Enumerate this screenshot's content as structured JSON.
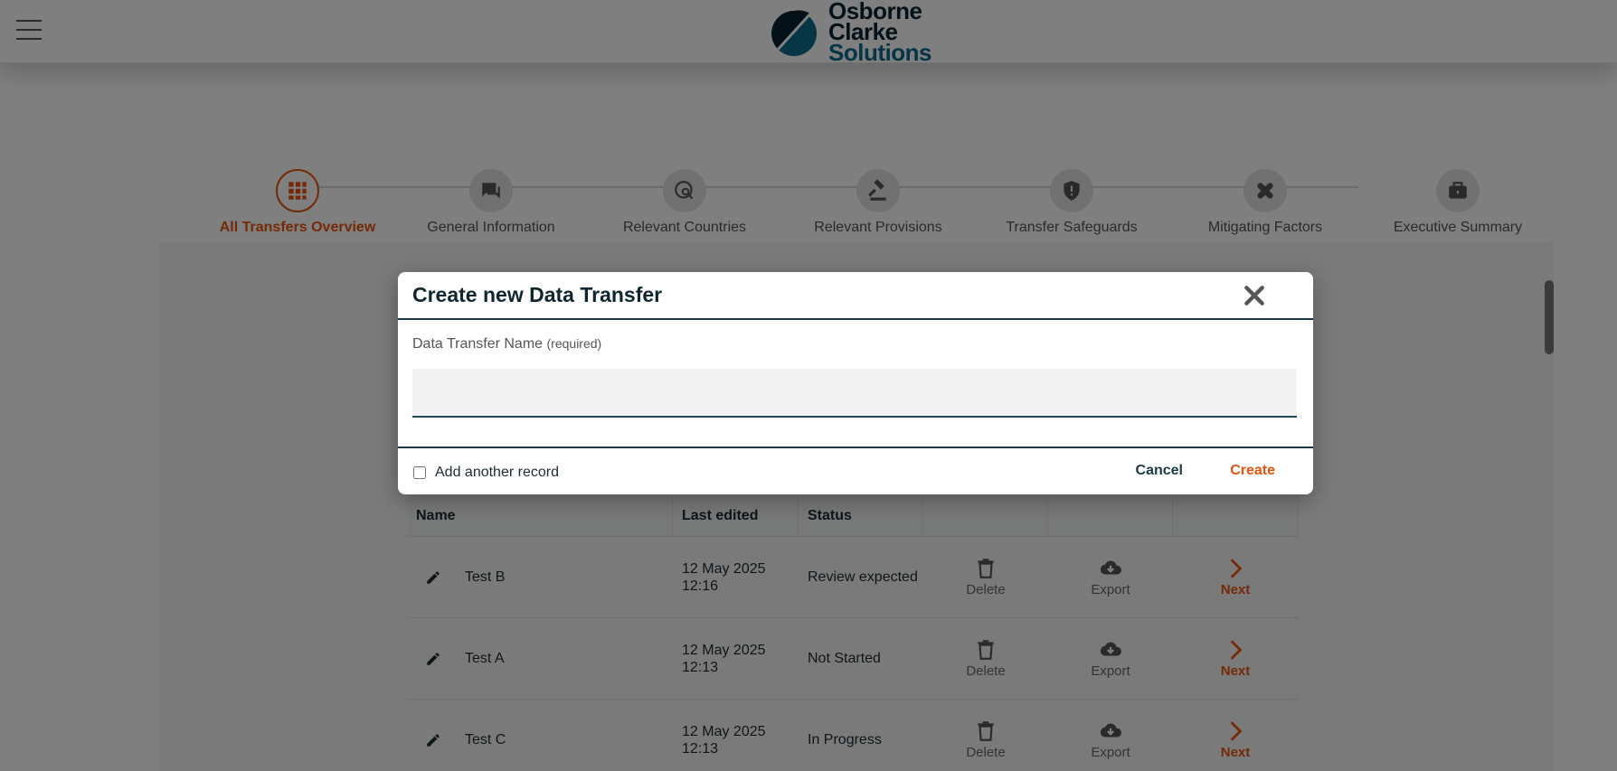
{
  "header": {
    "logo_lines": [
      "Osborne",
      "Clarke",
      "Solutions"
    ],
    "menu_icon": "hamburger-icon"
  },
  "steps": [
    {
      "label": "All Transfers Overview",
      "icon": "grid-icon",
      "active": true
    },
    {
      "label": "General Information",
      "icon": "chat-icon",
      "active": false
    },
    {
      "label": "Relevant Countries",
      "icon": "globe-search-icon",
      "active": false
    },
    {
      "label": "Relevant Provisions",
      "icon": "gavel-icon",
      "active": false
    },
    {
      "label": "Transfer Safeguards",
      "icon": "shield-icon",
      "active": false
    },
    {
      "label": "Mitigating Factors",
      "icon": "bandage-icon",
      "active": false
    },
    {
      "label": "Executive Summary",
      "icon": "briefcase-icon",
      "active": false
    }
  ],
  "table": {
    "headers": [
      "Name",
      "Last edited",
      "Status",
      "",
      "",
      ""
    ],
    "rows": [
      {
        "name": "Test B",
        "date": "12 May 2025",
        "time": "12:16",
        "status": "Review expected",
        "delete": "Delete",
        "export": "Export",
        "next": "Next"
      },
      {
        "name": "Test A",
        "date": "12 May 2025",
        "time": "12:13",
        "status": "Not Started",
        "delete": "Delete",
        "export": "Export",
        "next": "Next"
      },
      {
        "name": "Test C",
        "date": "12 May 2025",
        "time": "12:13",
        "status": "In Progress",
        "delete": "Delete",
        "export": "Export",
        "next": "Next"
      }
    ]
  },
  "modal": {
    "title": "Create new Data Transfer",
    "field_label": "Data Transfer Name",
    "field_required": "(required)",
    "field_value": "",
    "add_another_label": "Add another record",
    "add_another_checked": false,
    "cancel_label": "Cancel",
    "create_label": "Create"
  },
  "colors": {
    "accent": "#e8530e",
    "dark": "#0f2630",
    "brand_blue": "#0c6a8c"
  }
}
